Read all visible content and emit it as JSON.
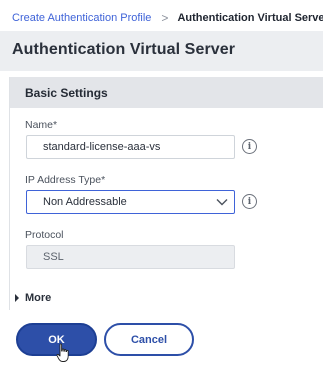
{
  "breadcrumb": {
    "parent": "Create Authentication Profile",
    "separator": ">",
    "current": "Authentication Virtual Server"
  },
  "page": {
    "title": "Authentication Virtual Server"
  },
  "basic_settings": {
    "title": "Basic Settings",
    "name": {
      "label": "Name*",
      "value": "standard-license-aaa-vs",
      "info_icon": "info-icon"
    },
    "ip_address_type": {
      "label": "IP Address Type*",
      "selected": "Non Addressable",
      "info_icon": "info-icon",
      "dropdown_icon": "chevron-down-icon"
    },
    "protocol": {
      "label": "Protocol",
      "value": "SSL"
    }
  },
  "more": {
    "label": "More",
    "icon": "triangle-right-icon"
  },
  "actions": {
    "ok_label": "OK",
    "cancel_label": "Cancel"
  },
  "colors": {
    "link": "#3f63d8",
    "primary": "#2d4fa8",
    "header_band": "#eceef1",
    "section_header": "#e3e5e9"
  }
}
